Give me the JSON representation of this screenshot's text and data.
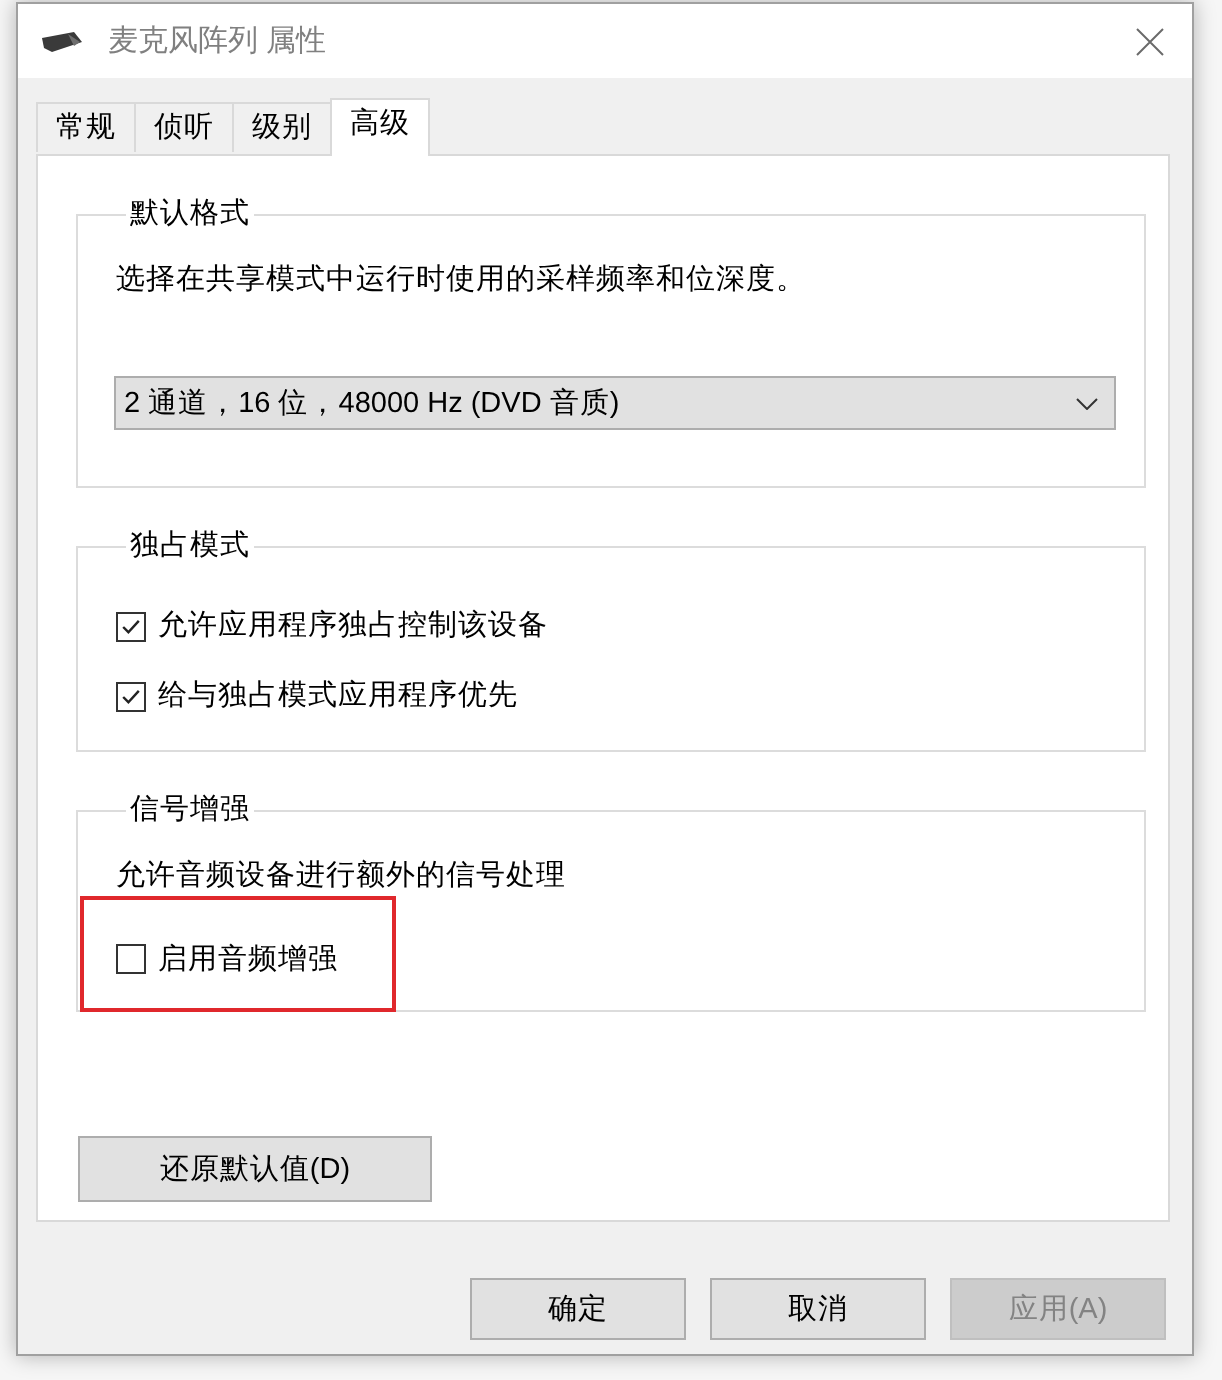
{
  "window": {
    "title": "麦克风阵列 属性"
  },
  "tabs": [
    {
      "label": "常规",
      "selected": false
    },
    {
      "label": "侦听",
      "selected": false
    },
    {
      "label": "级别",
      "selected": false
    },
    {
      "label": "高级",
      "selected": true
    }
  ],
  "groups": [
    {
      "kind": "format",
      "title": "默认格式",
      "description": "选择在共享模式中运行时使用的采样频率和位深度。",
      "dropdown": {
        "value": "2 通道，16 位，48000 Hz (DVD 音质)"
      }
    },
    {
      "kind": "options",
      "title": "独占模式",
      "options": [
        {
          "label": "允许应用程序独占控制该设备",
          "checked": true,
          "highlighted": false
        },
        {
          "label": "给与独占模式应用程序优先",
          "checked": true,
          "highlighted": false
        }
      ]
    },
    {
      "kind": "options",
      "title": "信号增强",
      "description": "允许音频设备进行额外的信号处理",
      "options": [
        {
          "label": "启用音频增强",
          "checked": false,
          "highlighted": true
        }
      ]
    }
  ],
  "restore_button": {
    "label": "还原默认值(D)"
  },
  "buttons": [
    {
      "label": "确定",
      "disabled": false
    },
    {
      "label": "取消",
      "disabled": false
    },
    {
      "label": "应用(A)",
      "disabled": true
    }
  ]
}
